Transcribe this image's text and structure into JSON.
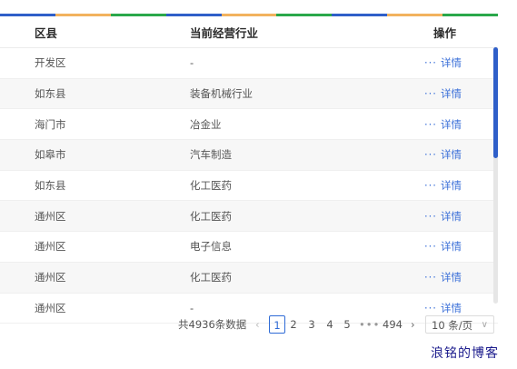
{
  "top_bar_colors": [
    "#2f5fc9",
    "#f2b25e",
    "#2aa84a",
    "#2f5fc9",
    "#f2b25e",
    "#2aa84a",
    "#2f5fc9",
    "#f2b25e",
    "#2aa84a"
  ],
  "table": {
    "headers": {
      "district": "区县",
      "industry": "当前经营行业",
      "action": "操作"
    },
    "rows": [
      {
        "district": "开发区",
        "industry": "-"
      },
      {
        "district": "如东县",
        "industry": "装备机械行业"
      },
      {
        "district": "海门市",
        "industry": "冶金业"
      },
      {
        "district": "如皋市",
        "industry": "汽车制造"
      },
      {
        "district": "如东县",
        "industry": "化工医药"
      },
      {
        "district": "通州区",
        "industry": "化工医药"
      },
      {
        "district": "通州区",
        "industry": "电子信息"
      },
      {
        "district": "通州区",
        "industry": "化工医药"
      },
      {
        "district": "通州区",
        "industry": "-"
      }
    ],
    "action_more": "···",
    "action_detail": "详情"
  },
  "pagination": {
    "total": "共4936条数据",
    "prev": "‹",
    "pages": [
      "1",
      "2",
      "3",
      "4",
      "5"
    ],
    "active_page": "1",
    "ellipsis": "•••",
    "last_page": "494",
    "next": "›",
    "page_size": "10 条/页"
  },
  "watermark": "浪铭的博客",
  "colors": {
    "link": "#3a6fd8",
    "accent": "#2f6bd6",
    "scroll_thumb": "#2f5fc9"
  }
}
